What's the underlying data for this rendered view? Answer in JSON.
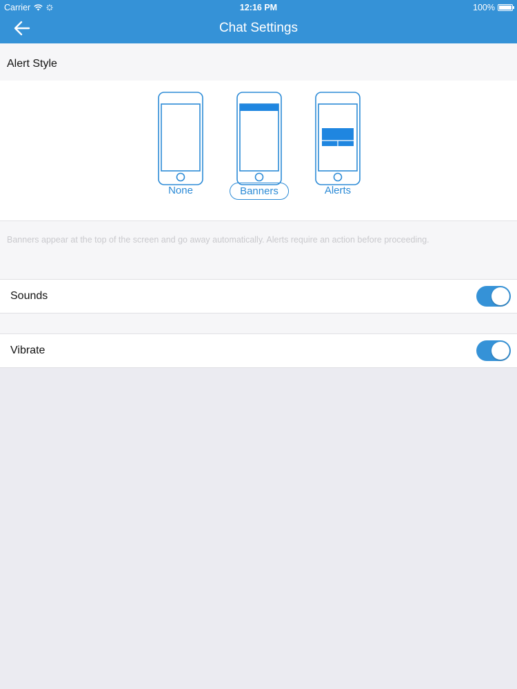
{
  "status_bar": {
    "carrier": "Carrier",
    "time": "12:16 PM",
    "battery": "100%",
    "battery_level": 1.0
  },
  "nav": {
    "title": "Chat Settings",
    "back_icon": "arrow-left-icon"
  },
  "alert_style": {
    "header": "Alert Style",
    "options": [
      {
        "label": "None",
        "selected": false
      },
      {
        "label": "Banners",
        "selected": true
      },
      {
        "label": "Alerts",
        "selected": false
      }
    ],
    "description": "Banners appear at the top of the screen and go away automatically. Alerts require an action before proceeding."
  },
  "settings": {
    "sounds": {
      "label": "Sounds",
      "enabled": true
    },
    "vibrate": {
      "label": "Vibrate",
      "enabled": true
    }
  },
  "colors": {
    "accent": "#3592d7",
    "link": "#2b8ad6",
    "background": "#ebebf1"
  }
}
